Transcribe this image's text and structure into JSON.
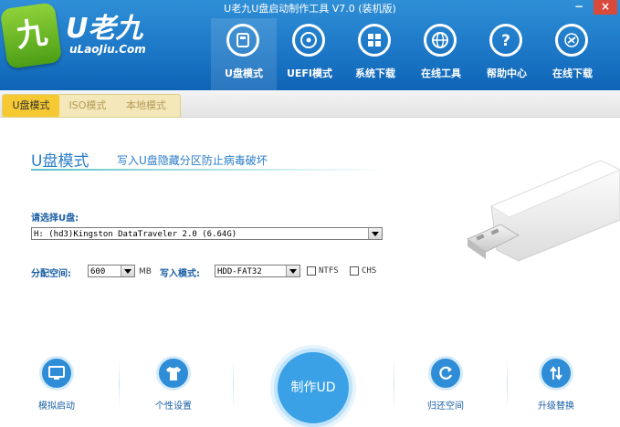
{
  "window": {
    "title": "U老九U盘启动制作工具 V7.0 (装机版)",
    "minimize": "−",
    "close": "×"
  },
  "logo": {
    "main": "U老九",
    "sub": "uLaoJiu.Com",
    "glyph": "九"
  },
  "nav": [
    {
      "label": "U盘模式",
      "icon": "usb-drive-icon"
    },
    {
      "label": "UEFI模式",
      "icon": "disc-icon"
    },
    {
      "label": "系统下载",
      "icon": "windows-logo-icon"
    },
    {
      "label": "在线工具",
      "icon": "globe-icon"
    },
    {
      "label": "帮助中心",
      "icon": "question-icon"
    },
    {
      "label": "在线下载",
      "icon": "download-icon"
    }
  ],
  "tabs": [
    {
      "label": "U盘模式",
      "active": true
    },
    {
      "label": "ISO模式",
      "active": false
    },
    {
      "label": "本地模式",
      "active": false
    }
  ],
  "mode": {
    "title": "U盘模式",
    "desc": "写入U盘隐藏分区防止病毒破坏"
  },
  "form": {
    "select_disk_label": "请选择U盘:",
    "disk_value": "H: (hd3)Kingston DataTraveler 2.0 (6.64G)",
    "alloc_label": "分配空间:",
    "alloc_value": "600",
    "alloc_unit": "MB",
    "write_mode_label": "写入模式:",
    "write_mode_value": "HDD-FAT32",
    "ntfs_label": "NTFS",
    "chs_label": "CHS"
  },
  "bottom": {
    "simulate": "模拟启动",
    "personal": "个性设置",
    "make": "制作UD",
    "restore": "归还空间",
    "upgrade": "升级替换"
  },
  "colors": {
    "header": "#1d78c7",
    "accent": "#2a7dc8",
    "tab_active": "#f6c933",
    "logo_green": "#6bb82a"
  }
}
